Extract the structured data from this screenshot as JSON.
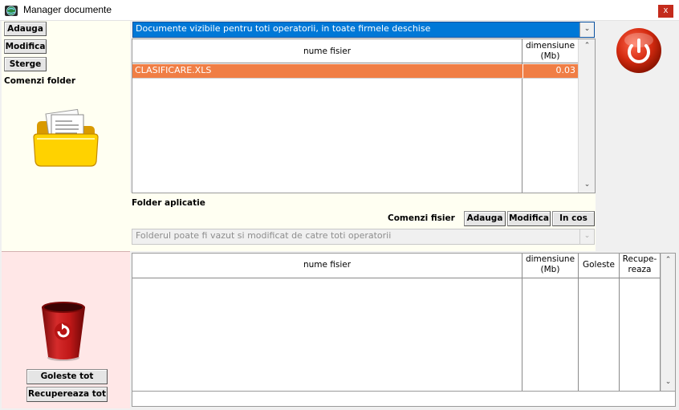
{
  "window": {
    "title": "Manager documente",
    "close_label": "x"
  },
  "folder_commands": {
    "add_label": "Adauga",
    "modify_label": "Modifica",
    "delete_label": "Sterge",
    "section_label": "Comenzi folder"
  },
  "visibility_dropdown": {
    "selected": "Documente vizibile pentru toti operatorii, in toate firmele deschise"
  },
  "files_table": {
    "col_name": "nume fisier",
    "col_size_line1": "dimensiune",
    "col_size_line2": "(Mb)",
    "rows": [
      {
        "name": "CLASIFICARE.XLS",
        "size": "0.03"
      }
    ]
  },
  "folder_section": {
    "label": "Folder aplicatie"
  },
  "file_commands": {
    "section_label": "Comenzi fisier",
    "add_label": "Adauga",
    "modify_label": "Modifica",
    "trash_label": "In cos"
  },
  "folder_dropdown": {
    "selected": "Folderul poate fi vazut si modificat de catre toti operatorii"
  },
  "trash_table": {
    "col_name": "nume fisier",
    "col_size_line1": "dimensiune",
    "col_size_line2": "(Mb)",
    "col_empty": "Goleste",
    "col_restore_line1": "Recupe-",
    "col_restore_line2": "reaza",
    "rows": []
  },
  "trash_commands": {
    "empty_all_label": "Goleste tot",
    "restore_all_label": "Recupereaza tot"
  },
  "icons": [
    "app-globe-icon",
    "power-icon",
    "document-folder-icon",
    "recycle-bin-icon"
  ],
  "colors": {
    "selection_blue": "#0078d7",
    "selected_row": "#f07e45",
    "close_red": "#c42b1c",
    "trash_panel": "#ffe7e7",
    "folder_panel": "#fffff2"
  }
}
